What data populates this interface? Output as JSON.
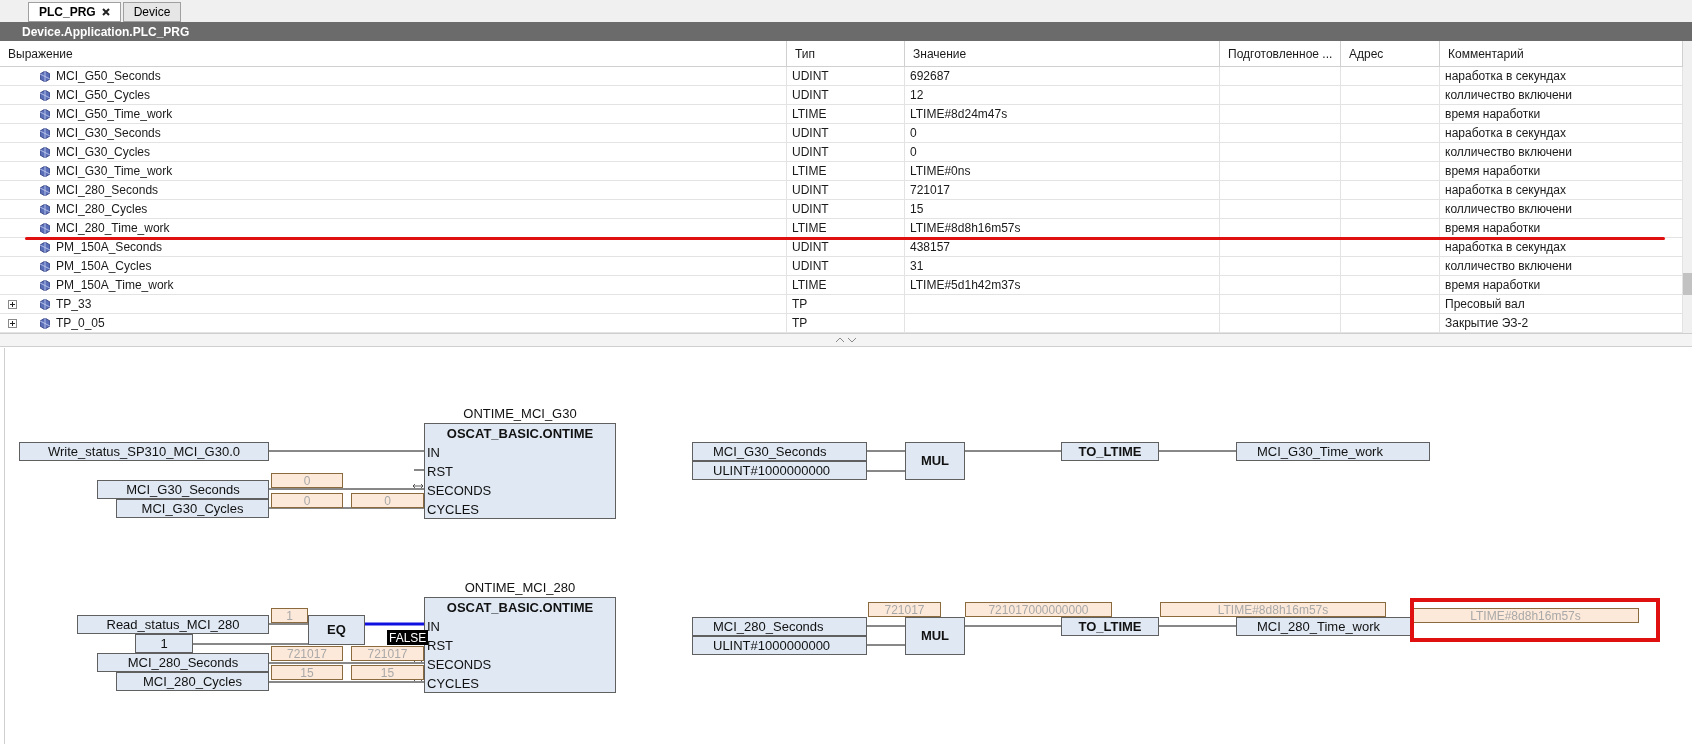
{
  "tabs": [
    {
      "label": "PLC_PRG",
      "selected": true,
      "closable": true
    },
    {
      "label": "Device",
      "selected": false,
      "closable": false
    }
  ],
  "editor_title": "Device.Application.PLC_PRG",
  "table": {
    "columns": [
      "Выражение",
      "Тип",
      "Значение",
      "Подготовленное ...",
      "Адрес",
      "Комментарий"
    ],
    "rows": [
      {
        "expression": "MCI_G50_Seconds",
        "type": "UDINT",
        "value": "692687",
        "comment": "наработка в секундах",
        "expandable": false
      },
      {
        "expression": "MCI_G50_Cycles",
        "type": "UDINT",
        "value": "12",
        "comment": "колличество включени",
        "expandable": false
      },
      {
        "expression": "MCI_G50_Time_work",
        "type": "LTIME",
        "value": "LTIME#8d24m47s",
        "comment": "время наработки",
        "expandable": false
      },
      {
        "expression": "MCI_G30_Seconds",
        "type": "UDINT",
        "value": "0",
        "comment": "наработка в секундах",
        "expandable": false
      },
      {
        "expression": "MCI_G30_Cycles",
        "type": "UDINT",
        "value": "0",
        "comment": "колличество включени",
        "expandable": false
      },
      {
        "expression": "MCI_G30_Time_work",
        "type": "LTIME",
        "value": "LTIME#0ns",
        "comment": "время наработки",
        "expandable": false
      },
      {
        "expression": "MCI_280_Seconds",
        "type": "UDINT",
        "value": "721017",
        "comment": "наработка в секундах",
        "expandable": false
      },
      {
        "expression": "MCI_280_Cycles",
        "type": "UDINT",
        "value": "15",
        "comment": "колличество включени",
        "expandable": false
      },
      {
        "expression": "MCI_280_Time_work",
        "type": "LTIME",
        "value": "LTIME#8d8h16m57s",
        "comment": "время наработки",
        "expandable": false
      },
      {
        "expression": "PM_150A_Seconds",
        "type": "UDINT",
        "value": "438157",
        "comment": "наработка в секундах",
        "expandable": false
      },
      {
        "expression": "PM_150A_Cycles",
        "type": "UDINT",
        "value": "31",
        "comment": "колличество включени",
        "expandable": false
      },
      {
        "expression": "PM_150A_Time_work",
        "type": "LTIME",
        "value": "LTIME#5d1h42m37s",
        "comment": "время наработки",
        "expandable": false
      },
      {
        "expression": "TP_33",
        "type": "TP",
        "value": "",
        "comment": "Пресовый вал",
        "expandable": true
      },
      {
        "expression": "TP_0_05",
        "type": "TP",
        "value": "",
        "comment": "Закрытие ЭЗ-2",
        "expandable": true
      }
    ]
  },
  "diagram": {
    "variables": [
      "Write_status_SP310_MCI_G30.0",
      "MCI_G30_Seconds",
      "MCI_G30_Cycles",
      "Read_status_MCI_280",
      "1",
      "MCI_280_Seconds",
      "MCI_280_Cycles",
      "MCI_G30_Seconds",
      "ULINT#1000000000",
      "MCI_G30_Time_work",
      "MCI_280_Seconds",
      "ULINT#1000000000",
      "MCI_280_Time_work"
    ],
    "function_blocks": [
      {
        "instance": "ONTIME_MCI_G30",
        "type": "OSCAT_BASIC.ONTIME",
        "pins": [
          {
            "name": "IN",
            "kind": "input"
          },
          {
            "name": "RST",
            "kind": "input"
          },
          {
            "name": "SECONDS",
            "kind": "in_out"
          },
          {
            "name": "CYCLES",
            "kind": "in_out"
          }
        ]
      },
      {
        "instance": "ONTIME_MCI_280",
        "type": "OSCAT_BASIC.ONTIME",
        "pins": [
          {
            "name": "IN",
            "kind": "input"
          },
          {
            "name": "RST",
            "kind": "input"
          },
          {
            "name": "SECONDS",
            "kind": "in_out"
          },
          {
            "name": "CYCLES",
            "kind": "in_out"
          }
        ]
      }
    ],
    "operators": [
      "EQ",
      "MUL",
      "TO_LTIME",
      "MUL",
      "TO_LTIME"
    ],
    "watch_values": [
      "0",
      "0",
      "0",
      "1",
      "721017",
      "721017",
      "15",
      "15",
      "721017",
      "721017000000000",
      "LTIME#8d8h16m57s",
      "LTIME#8d8h16m57s"
    ],
    "status_flags": [
      "FALSE"
    ]
  }
}
